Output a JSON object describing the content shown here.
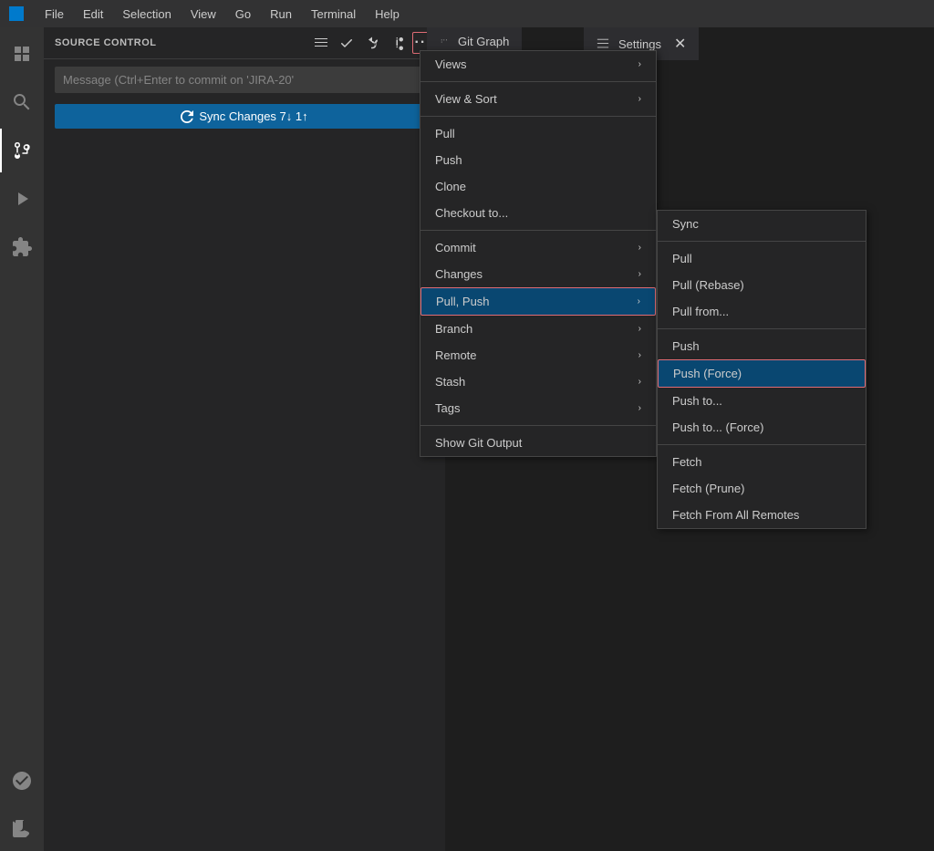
{
  "titlebar": {
    "menu_items": [
      "File",
      "Edit",
      "Selection",
      "View",
      "Go",
      "Run",
      "Terminal",
      "Help"
    ]
  },
  "source_control": {
    "title": "SOURCE CONTROL",
    "message_placeholder": "Message (Ctrl+Enter to commit on 'JIRA-20'",
    "sync_button": "Sync Changes 7↓ 1↑",
    "git_graph_label": "Git Graph",
    "settings_label": "Settings"
  },
  "dropdown": {
    "items": [
      {
        "label": "Views",
        "has_arrow": true
      },
      {
        "label": "View & Sort",
        "has_arrow": true
      },
      {
        "label": "Pull",
        "has_arrow": false
      },
      {
        "label": "Push",
        "has_arrow": false
      },
      {
        "label": "Clone",
        "has_arrow": false
      },
      {
        "label": "Checkout to...",
        "has_arrow": false
      },
      {
        "label": "Commit",
        "has_arrow": true
      },
      {
        "label": "Changes",
        "has_arrow": true
      },
      {
        "label": "Pull, Push",
        "has_arrow": true,
        "active": true
      },
      {
        "label": "Branch",
        "has_arrow": true
      },
      {
        "label": "Remote",
        "has_arrow": true
      },
      {
        "label": "Stash",
        "has_arrow": true
      },
      {
        "label": "Tags",
        "has_arrow": true
      },
      {
        "label": "Show Git Output",
        "has_arrow": false
      }
    ]
  },
  "pullpush_submenu": {
    "items": [
      {
        "label": "Sync",
        "separator_after": true
      },
      {
        "label": "Pull"
      },
      {
        "label": "Pull (Rebase)"
      },
      {
        "label": "Pull from...",
        "separator_after": true
      },
      {
        "label": "Push"
      },
      {
        "label": "Push (Force)",
        "highlighted": true
      },
      {
        "label": "Push to..."
      },
      {
        "label": "Push to... (Force)",
        "separator_after": true
      },
      {
        "label": "Fetch"
      },
      {
        "label": "Fetch (Prune)"
      },
      {
        "label": "Fetch From All Remotes"
      }
    ]
  },
  "activity_icons": [
    {
      "name": "explorer",
      "symbol": "⬜"
    },
    {
      "name": "search",
      "symbol": "🔍"
    },
    {
      "name": "source-control",
      "symbol": "⑂",
      "active": true
    },
    {
      "name": "run-debug",
      "symbol": "▷"
    },
    {
      "name": "extensions",
      "symbol": "⊞"
    },
    {
      "name": "remote-explorer",
      "symbol": "⊙"
    },
    {
      "name": "testing",
      "symbol": "⚗"
    }
  ]
}
